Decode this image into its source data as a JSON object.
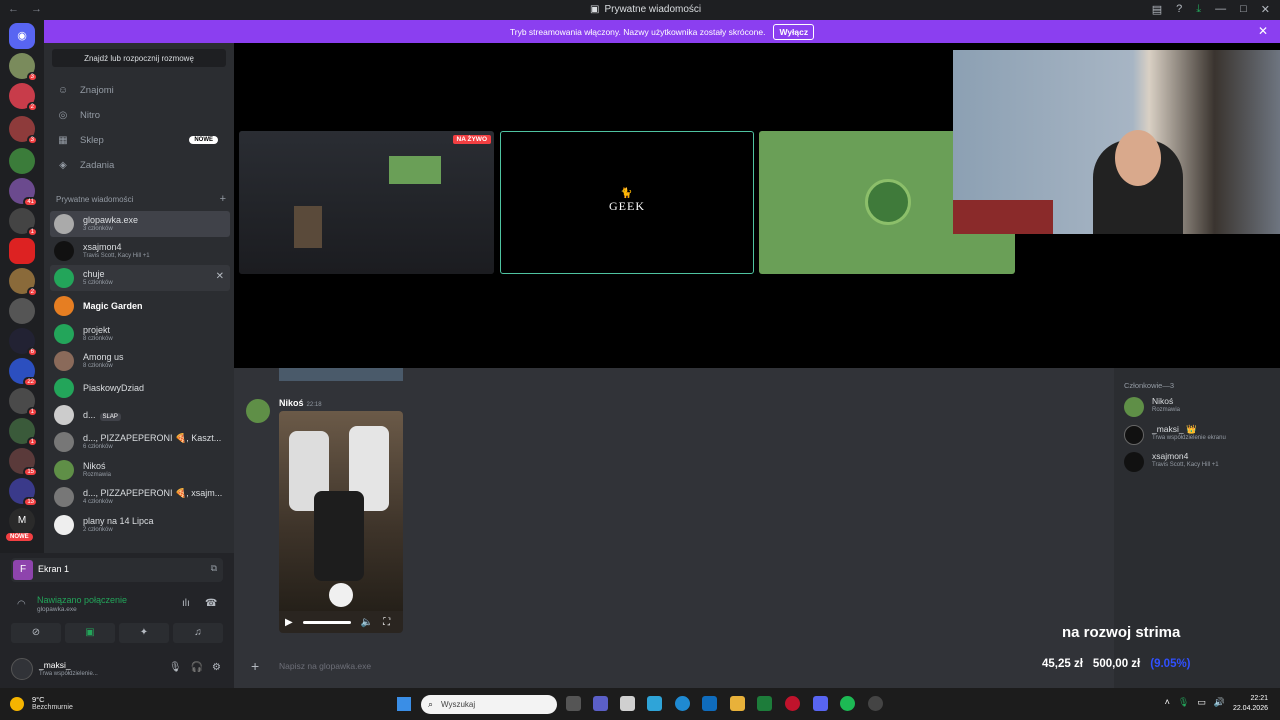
{
  "window": {
    "title": "Prywatne wiadomości"
  },
  "banner": {
    "text": "Tryb streamowania włączony. Nazwy użytkownika zostały skrócone.",
    "button": "Wyłącz"
  },
  "rail": {
    "badges": [
      "3",
      "2",
      "3",
      "41",
      "1",
      "2",
      "6",
      "22",
      "1",
      "1",
      "15",
      "13",
      "1"
    ],
    "m_label": "M",
    "nowe_label": "NOWE"
  },
  "sidebar": {
    "search": "Znajdź lub rozpocznij rozmowę",
    "nav": [
      {
        "label": "Znajomi",
        "icon": "friends-icon"
      },
      {
        "label": "Nitro",
        "icon": "nitro-icon"
      },
      {
        "label": "Sklep",
        "icon": "shop-icon",
        "badge": "NOWE"
      },
      {
        "label": "Zadania",
        "icon": "quests-icon"
      }
    ],
    "dm_header": "Prywatne wiadomości",
    "dms": [
      {
        "name": "glopawka.exe",
        "sub": "3 członków"
      },
      {
        "name": "xsajmon4",
        "sub": "Travis Scott, Kacy Hill +1"
      },
      {
        "name": "chuje",
        "sub": "5 członków"
      },
      {
        "name": "Magic Garden",
        "sub": ""
      },
      {
        "name": "projekt",
        "sub": "8 członków"
      },
      {
        "name": "Among us",
        "sub": "8 członków"
      },
      {
        "name": "PiaskowyDziad",
        "sub": ""
      },
      {
        "name": "d...",
        "sub": "",
        "tag": "SLAP"
      },
      {
        "name": "d..., PIZZAPEPERONI 🍕, Kaszt...",
        "sub": "6 członków"
      },
      {
        "name": "Nikoś",
        "sub": "Rozmawia"
      },
      {
        "name": "d..., PIZZAPEPERONI 🍕, xsajm...",
        "sub": "4 członków"
      },
      {
        "name": "plany na 14 Lipca",
        "sub": "2 członków"
      }
    ]
  },
  "voice": {
    "screen": "Ekran 1",
    "screen_letter": "F",
    "status": "Nawiązano połączenie",
    "channel": "glopawka.exe",
    "user_name": "_maksi_",
    "user_status": "Trwa współdzielenie..."
  },
  "stage": {
    "live": "NA ŻYWO",
    "geek": "GEEK"
  },
  "chat": {
    "author": "Nikoś",
    "time": "22:18",
    "placeholder": "Napisz na glopawka.exe"
  },
  "members": {
    "header": "Członkowie—3",
    "list": [
      {
        "name": "Nikoś",
        "status": "Rozmawia"
      },
      {
        "name": "_maksi_ 👑",
        "status": "Trwa współdzielenie ekranu"
      },
      {
        "name": "xsajmon4",
        "status": "Travis Scott, Kacy Hill +1"
      }
    ]
  },
  "overlay": {
    "title": "na rozwoj strima",
    "current": "45,25 zł",
    "goal": "500,00 zł",
    "percent": "(9.05%)"
  },
  "taskbar": {
    "temp": "9°C",
    "weather": "Bezchmurnie",
    "search": "Wyszukaj",
    "time": "22:21",
    "date": "22.04.2026"
  },
  "colors": {
    "accent": "#8b3ff0",
    "online": "#23a55a",
    "badge": "#f23f42"
  }
}
